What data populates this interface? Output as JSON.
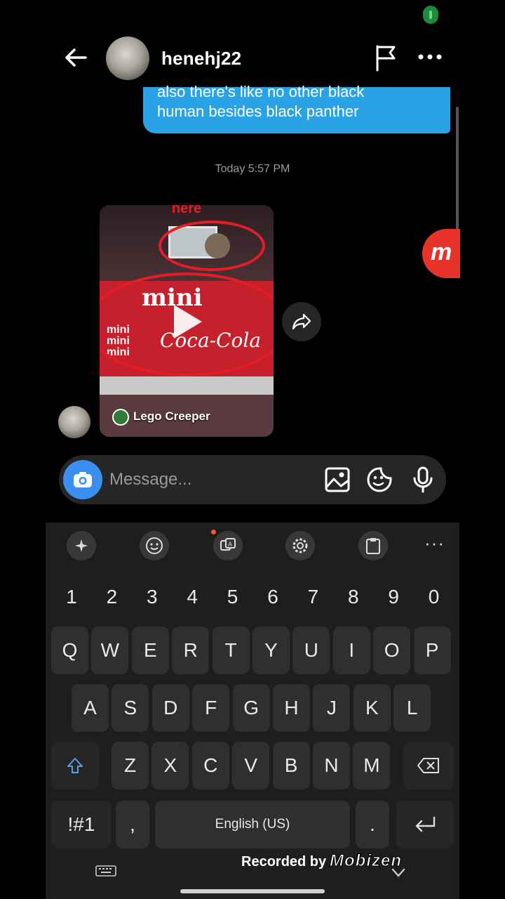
{
  "header": {
    "username": "henehj22"
  },
  "messages": {
    "sent_line1": "also there's like no other black",
    "sent_line2": "human besides black panther",
    "timestamp": "Today 5:57 PM",
    "reel": {
      "overlay_text": "here",
      "product_text": "mini",
      "brand_text": "Coca-Cola",
      "stacked_text": "mini mini mini",
      "author": "Lego Creeper"
    }
  },
  "composer": {
    "placeholder": "Message..."
  },
  "keyboard": {
    "number_row": [
      "1",
      "2",
      "3",
      "4",
      "5",
      "6",
      "7",
      "8",
      "9",
      "0"
    ],
    "row1": [
      "Q",
      "W",
      "E",
      "R",
      "T",
      "Y",
      "U",
      "I",
      "O",
      "P"
    ],
    "row2": [
      "A",
      "S",
      "D",
      "F",
      "G",
      "H",
      "J",
      "K",
      "L"
    ],
    "row3": [
      "Z",
      "X",
      "C",
      "V",
      "B",
      "N",
      "M"
    ],
    "symbols_key": "!#1",
    "comma_key": ",",
    "space_label": "English (US)",
    "period_key": ".",
    "more_label": "···"
  },
  "overlay": {
    "recorded_by": "Recorded by",
    "brand": "Mobizen",
    "float_logo": "m"
  },
  "colors": {
    "sent_bubble": "#2aa3e6",
    "camera_button": "#3b8ff0",
    "keyboard_bg": "#1e1e1e",
    "key_bg": "#2f2f2f"
  }
}
